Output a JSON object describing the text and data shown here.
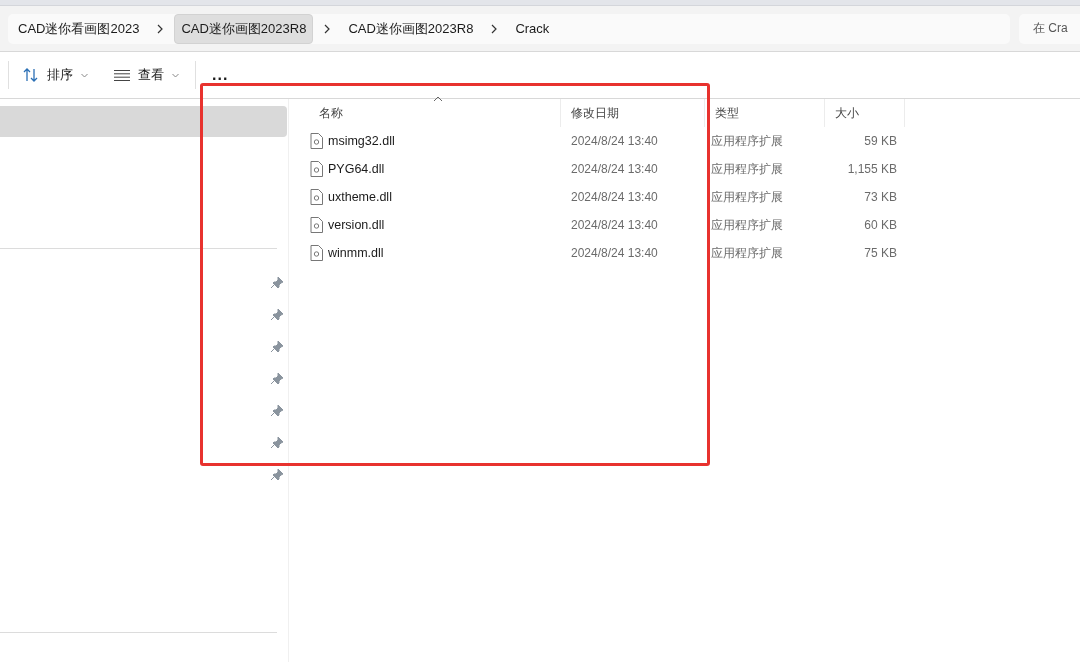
{
  "breadcrumbs": [
    {
      "label": "CAD迷你看画图2023",
      "highlighted": false
    },
    {
      "label": "CAD迷你画图2023R8",
      "highlighted": true
    },
    {
      "label": "CAD迷你画图2023R8",
      "highlighted": false
    },
    {
      "label": "Crack",
      "highlighted": false
    }
  ],
  "search": {
    "placeholder": "在 Cra"
  },
  "toolbar": [
    {
      "kind": "sort",
      "label": "排序"
    },
    {
      "kind": "view",
      "label": "查看"
    },
    {
      "kind": "more",
      "label": "..."
    }
  ],
  "sidebar": {
    "top_item": {
      "selected": true
    },
    "pinned_items": [
      {
        "pinned": true
      },
      {
        "pinned": true
      },
      {
        "pinned": true
      },
      {
        "pinned": true
      },
      {
        "pinned": true
      },
      {
        "pinned": true
      },
      {
        "pinned": true
      }
    ]
  },
  "table": {
    "columns": [
      {
        "label": "名称",
        "sorted": true
      },
      {
        "label": "修改日期",
        "sorted": false
      },
      {
        "label": "类型",
        "sorted": false
      },
      {
        "label": "大小",
        "sorted": false
      }
    ],
    "rows": [
      [
        "msimg32.dll",
        "2024/8/24 13:40",
        "应用程序扩展",
        "59 KB"
      ],
      [
        "PYG64.dll",
        "2024/8/24 13:40",
        "应用程序扩展",
        "1,155 KB"
      ],
      [
        "uxtheme.dll",
        "2024/8/24 13:40",
        "应用程序扩展",
        "73 KB"
      ],
      [
        "version.dll",
        "2024/8/24 13:40",
        "应用程序扩展",
        "60 KB"
      ],
      [
        "winmm.dll",
        "2024/8/24 13:40",
        "应用程序扩展",
        "75 KB"
      ]
    ]
  },
  "annotation": {
    "kind": "rectangle",
    "color": "#e8322e"
  }
}
